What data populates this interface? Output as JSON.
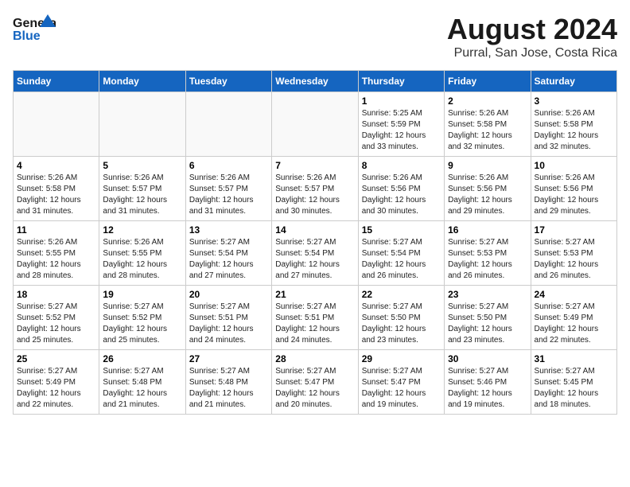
{
  "header": {
    "logo_line1": "General",
    "logo_line2": "Blue",
    "month_year": "August 2024",
    "location": "Purral, San Jose, Costa Rica"
  },
  "weekdays": [
    "Sunday",
    "Monday",
    "Tuesday",
    "Wednesday",
    "Thursday",
    "Friday",
    "Saturday"
  ],
  "weeks": [
    [
      {
        "day": "",
        "info": ""
      },
      {
        "day": "",
        "info": ""
      },
      {
        "day": "",
        "info": ""
      },
      {
        "day": "",
        "info": ""
      },
      {
        "day": "1",
        "info": "Sunrise: 5:25 AM\nSunset: 5:59 PM\nDaylight: 12 hours\nand 33 minutes."
      },
      {
        "day": "2",
        "info": "Sunrise: 5:26 AM\nSunset: 5:58 PM\nDaylight: 12 hours\nand 32 minutes."
      },
      {
        "day": "3",
        "info": "Sunrise: 5:26 AM\nSunset: 5:58 PM\nDaylight: 12 hours\nand 32 minutes."
      }
    ],
    [
      {
        "day": "4",
        "info": "Sunrise: 5:26 AM\nSunset: 5:58 PM\nDaylight: 12 hours\nand 31 minutes."
      },
      {
        "day": "5",
        "info": "Sunrise: 5:26 AM\nSunset: 5:57 PM\nDaylight: 12 hours\nand 31 minutes."
      },
      {
        "day": "6",
        "info": "Sunrise: 5:26 AM\nSunset: 5:57 PM\nDaylight: 12 hours\nand 31 minutes."
      },
      {
        "day": "7",
        "info": "Sunrise: 5:26 AM\nSunset: 5:57 PM\nDaylight: 12 hours\nand 30 minutes."
      },
      {
        "day": "8",
        "info": "Sunrise: 5:26 AM\nSunset: 5:56 PM\nDaylight: 12 hours\nand 30 minutes."
      },
      {
        "day": "9",
        "info": "Sunrise: 5:26 AM\nSunset: 5:56 PM\nDaylight: 12 hours\nand 29 minutes."
      },
      {
        "day": "10",
        "info": "Sunrise: 5:26 AM\nSunset: 5:56 PM\nDaylight: 12 hours\nand 29 minutes."
      }
    ],
    [
      {
        "day": "11",
        "info": "Sunrise: 5:26 AM\nSunset: 5:55 PM\nDaylight: 12 hours\nand 28 minutes."
      },
      {
        "day": "12",
        "info": "Sunrise: 5:26 AM\nSunset: 5:55 PM\nDaylight: 12 hours\nand 28 minutes."
      },
      {
        "day": "13",
        "info": "Sunrise: 5:27 AM\nSunset: 5:54 PM\nDaylight: 12 hours\nand 27 minutes."
      },
      {
        "day": "14",
        "info": "Sunrise: 5:27 AM\nSunset: 5:54 PM\nDaylight: 12 hours\nand 27 minutes."
      },
      {
        "day": "15",
        "info": "Sunrise: 5:27 AM\nSunset: 5:54 PM\nDaylight: 12 hours\nand 26 minutes."
      },
      {
        "day": "16",
        "info": "Sunrise: 5:27 AM\nSunset: 5:53 PM\nDaylight: 12 hours\nand 26 minutes."
      },
      {
        "day": "17",
        "info": "Sunrise: 5:27 AM\nSunset: 5:53 PM\nDaylight: 12 hours\nand 26 minutes."
      }
    ],
    [
      {
        "day": "18",
        "info": "Sunrise: 5:27 AM\nSunset: 5:52 PM\nDaylight: 12 hours\nand 25 minutes."
      },
      {
        "day": "19",
        "info": "Sunrise: 5:27 AM\nSunset: 5:52 PM\nDaylight: 12 hours\nand 25 minutes."
      },
      {
        "day": "20",
        "info": "Sunrise: 5:27 AM\nSunset: 5:51 PM\nDaylight: 12 hours\nand 24 minutes."
      },
      {
        "day": "21",
        "info": "Sunrise: 5:27 AM\nSunset: 5:51 PM\nDaylight: 12 hours\nand 24 minutes."
      },
      {
        "day": "22",
        "info": "Sunrise: 5:27 AM\nSunset: 5:50 PM\nDaylight: 12 hours\nand 23 minutes."
      },
      {
        "day": "23",
        "info": "Sunrise: 5:27 AM\nSunset: 5:50 PM\nDaylight: 12 hours\nand 23 minutes."
      },
      {
        "day": "24",
        "info": "Sunrise: 5:27 AM\nSunset: 5:49 PM\nDaylight: 12 hours\nand 22 minutes."
      }
    ],
    [
      {
        "day": "25",
        "info": "Sunrise: 5:27 AM\nSunset: 5:49 PM\nDaylight: 12 hours\nand 22 minutes."
      },
      {
        "day": "26",
        "info": "Sunrise: 5:27 AM\nSunset: 5:48 PM\nDaylight: 12 hours\nand 21 minutes."
      },
      {
        "day": "27",
        "info": "Sunrise: 5:27 AM\nSunset: 5:48 PM\nDaylight: 12 hours\nand 21 minutes."
      },
      {
        "day": "28",
        "info": "Sunrise: 5:27 AM\nSunset: 5:47 PM\nDaylight: 12 hours\nand 20 minutes."
      },
      {
        "day": "29",
        "info": "Sunrise: 5:27 AM\nSunset: 5:47 PM\nDaylight: 12 hours\nand 19 minutes."
      },
      {
        "day": "30",
        "info": "Sunrise: 5:27 AM\nSunset: 5:46 PM\nDaylight: 12 hours\nand 19 minutes."
      },
      {
        "day": "31",
        "info": "Sunrise: 5:27 AM\nSunset: 5:45 PM\nDaylight: 12 hours\nand 18 minutes."
      }
    ]
  ]
}
